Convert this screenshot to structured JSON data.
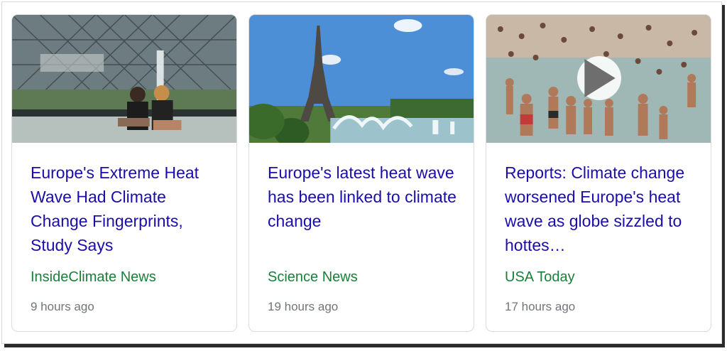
{
  "cards": [
    {
      "headline": "Europe's Extreme Heat Wave Had Climate Change Fingerprints, Study Says",
      "source": "InsideClimate News",
      "time": "9 hours ago",
      "image_icon": "image-louvre-fountain"
    },
    {
      "headline": "Europe's latest heat wave has been linked to climate change",
      "source": "Science News",
      "time": "19 hours ago",
      "image_icon": "image-eiffel-tower-fountain"
    },
    {
      "headline": "Reports: Climate change worsened Europe's heat wave as globe sizzled to hottes…",
      "source": "USA Today",
      "time": "17 hours ago",
      "image_icon": "image-crowd-in-fountain",
      "has_video": true
    }
  ],
  "colors": {
    "headline": "#1a0dab",
    "source": "#188038",
    "time": "#70757a"
  }
}
